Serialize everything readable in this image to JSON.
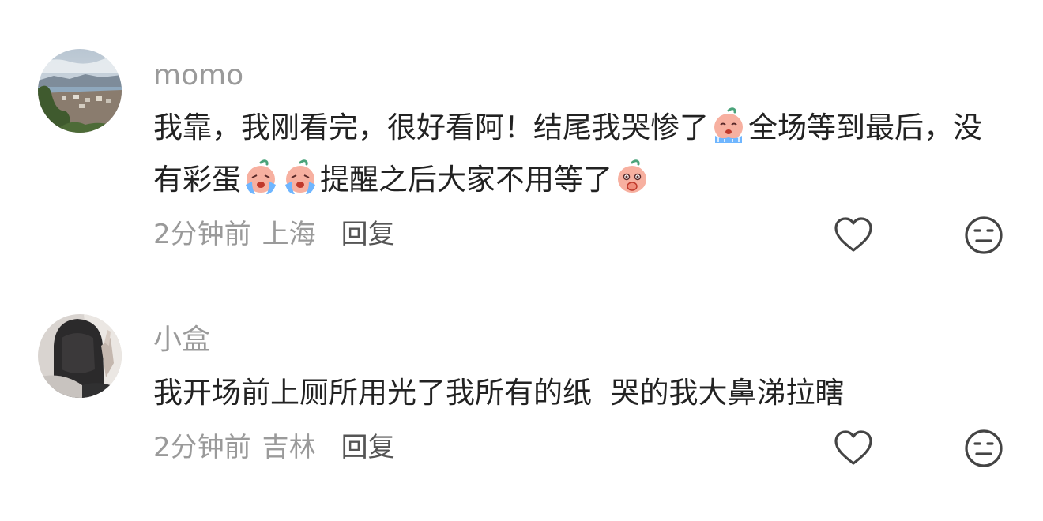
{
  "comments": [
    {
      "username": "momo",
      "text_parts": {
        "p1": "我靠，我刚看完，很好看阿！结尾我哭惨了",
        "p2": "全场等到最后，没有彩蛋",
        "p3": "提醒之后大家不用等了"
      },
      "time": "2分钟前",
      "location": "上海",
      "reply_label": "回复",
      "emojis": [
        "crying-peach-emoji",
        "crying-peach-emoji",
        "crying-peach-emoji",
        "shocked-peach-emoji"
      ]
    },
    {
      "username": "小盒",
      "text": "我开场前上厕所用光了我所有的纸  哭的我大鼻涕拉瞎",
      "time": "2分钟前",
      "location": "吉林",
      "reply_label": "回复"
    }
  ],
  "icons": {
    "like": "heart-outline-icon",
    "dislike": "meh-face-icon"
  },
  "colors": {
    "meta_gray": "#9a9a9a",
    "reply_gray": "#555555",
    "icon_gray": "#444444",
    "peach": "#f7b0a0",
    "tear_blue": "#6fb6ff"
  }
}
